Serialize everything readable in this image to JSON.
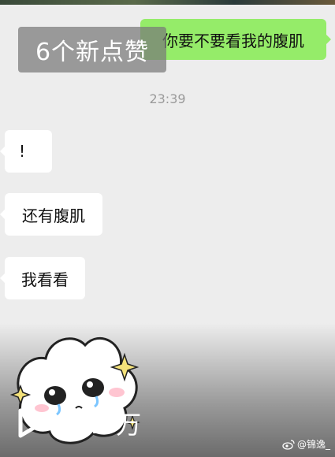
{
  "overlay": {
    "likes_text": "6个新点赞"
  },
  "messages": [
    {
      "side": "right",
      "text": "你要不要看我的腹肌"
    },
    {
      "side": "left",
      "text": "!"
    },
    {
      "side": "left",
      "text": "还有腹肌"
    },
    {
      "side": "left",
      "text": "我看看"
    }
  ],
  "timestamp": "23:39",
  "stats": {
    "play_icon": "play-icon",
    "views": "11.4万"
  },
  "watermark": {
    "icon": "weibo-icon",
    "text": "@锦逸_"
  },
  "colors": {
    "background": "#ededed",
    "sent_bubble": "#95ec69",
    "received_bubble": "#ffffff"
  }
}
